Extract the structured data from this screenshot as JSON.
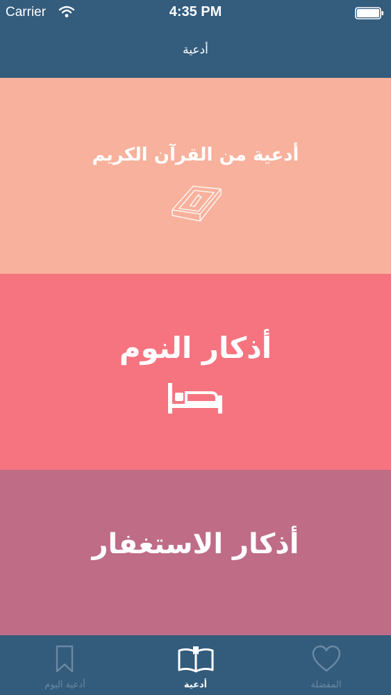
{
  "status_bar": {
    "carrier": "Carrier",
    "time": "4:35 PM"
  },
  "nav": {
    "title": "أدعية"
  },
  "tiles": [
    {
      "title": "أدعية من القرآن الكريم",
      "icon": "quran-book-icon",
      "color": "#f8b19c"
    },
    {
      "title": "أذكار النوم",
      "icon": "bed-icon",
      "color": "#f67480"
    },
    {
      "title": "أذكار الاستغفار",
      "color": "#bf6c87"
    }
  ],
  "tabs": [
    {
      "label": "أدعية اليوم",
      "icon": "bookmark-icon",
      "active": false
    },
    {
      "label": "أدعية",
      "icon": "open-book-icon",
      "active": true
    },
    {
      "label": "المفضلة",
      "icon": "heart-icon",
      "active": false
    }
  ],
  "colors": {
    "bar": "#345c7d",
    "tab_inactive": "#6c8aa3"
  }
}
